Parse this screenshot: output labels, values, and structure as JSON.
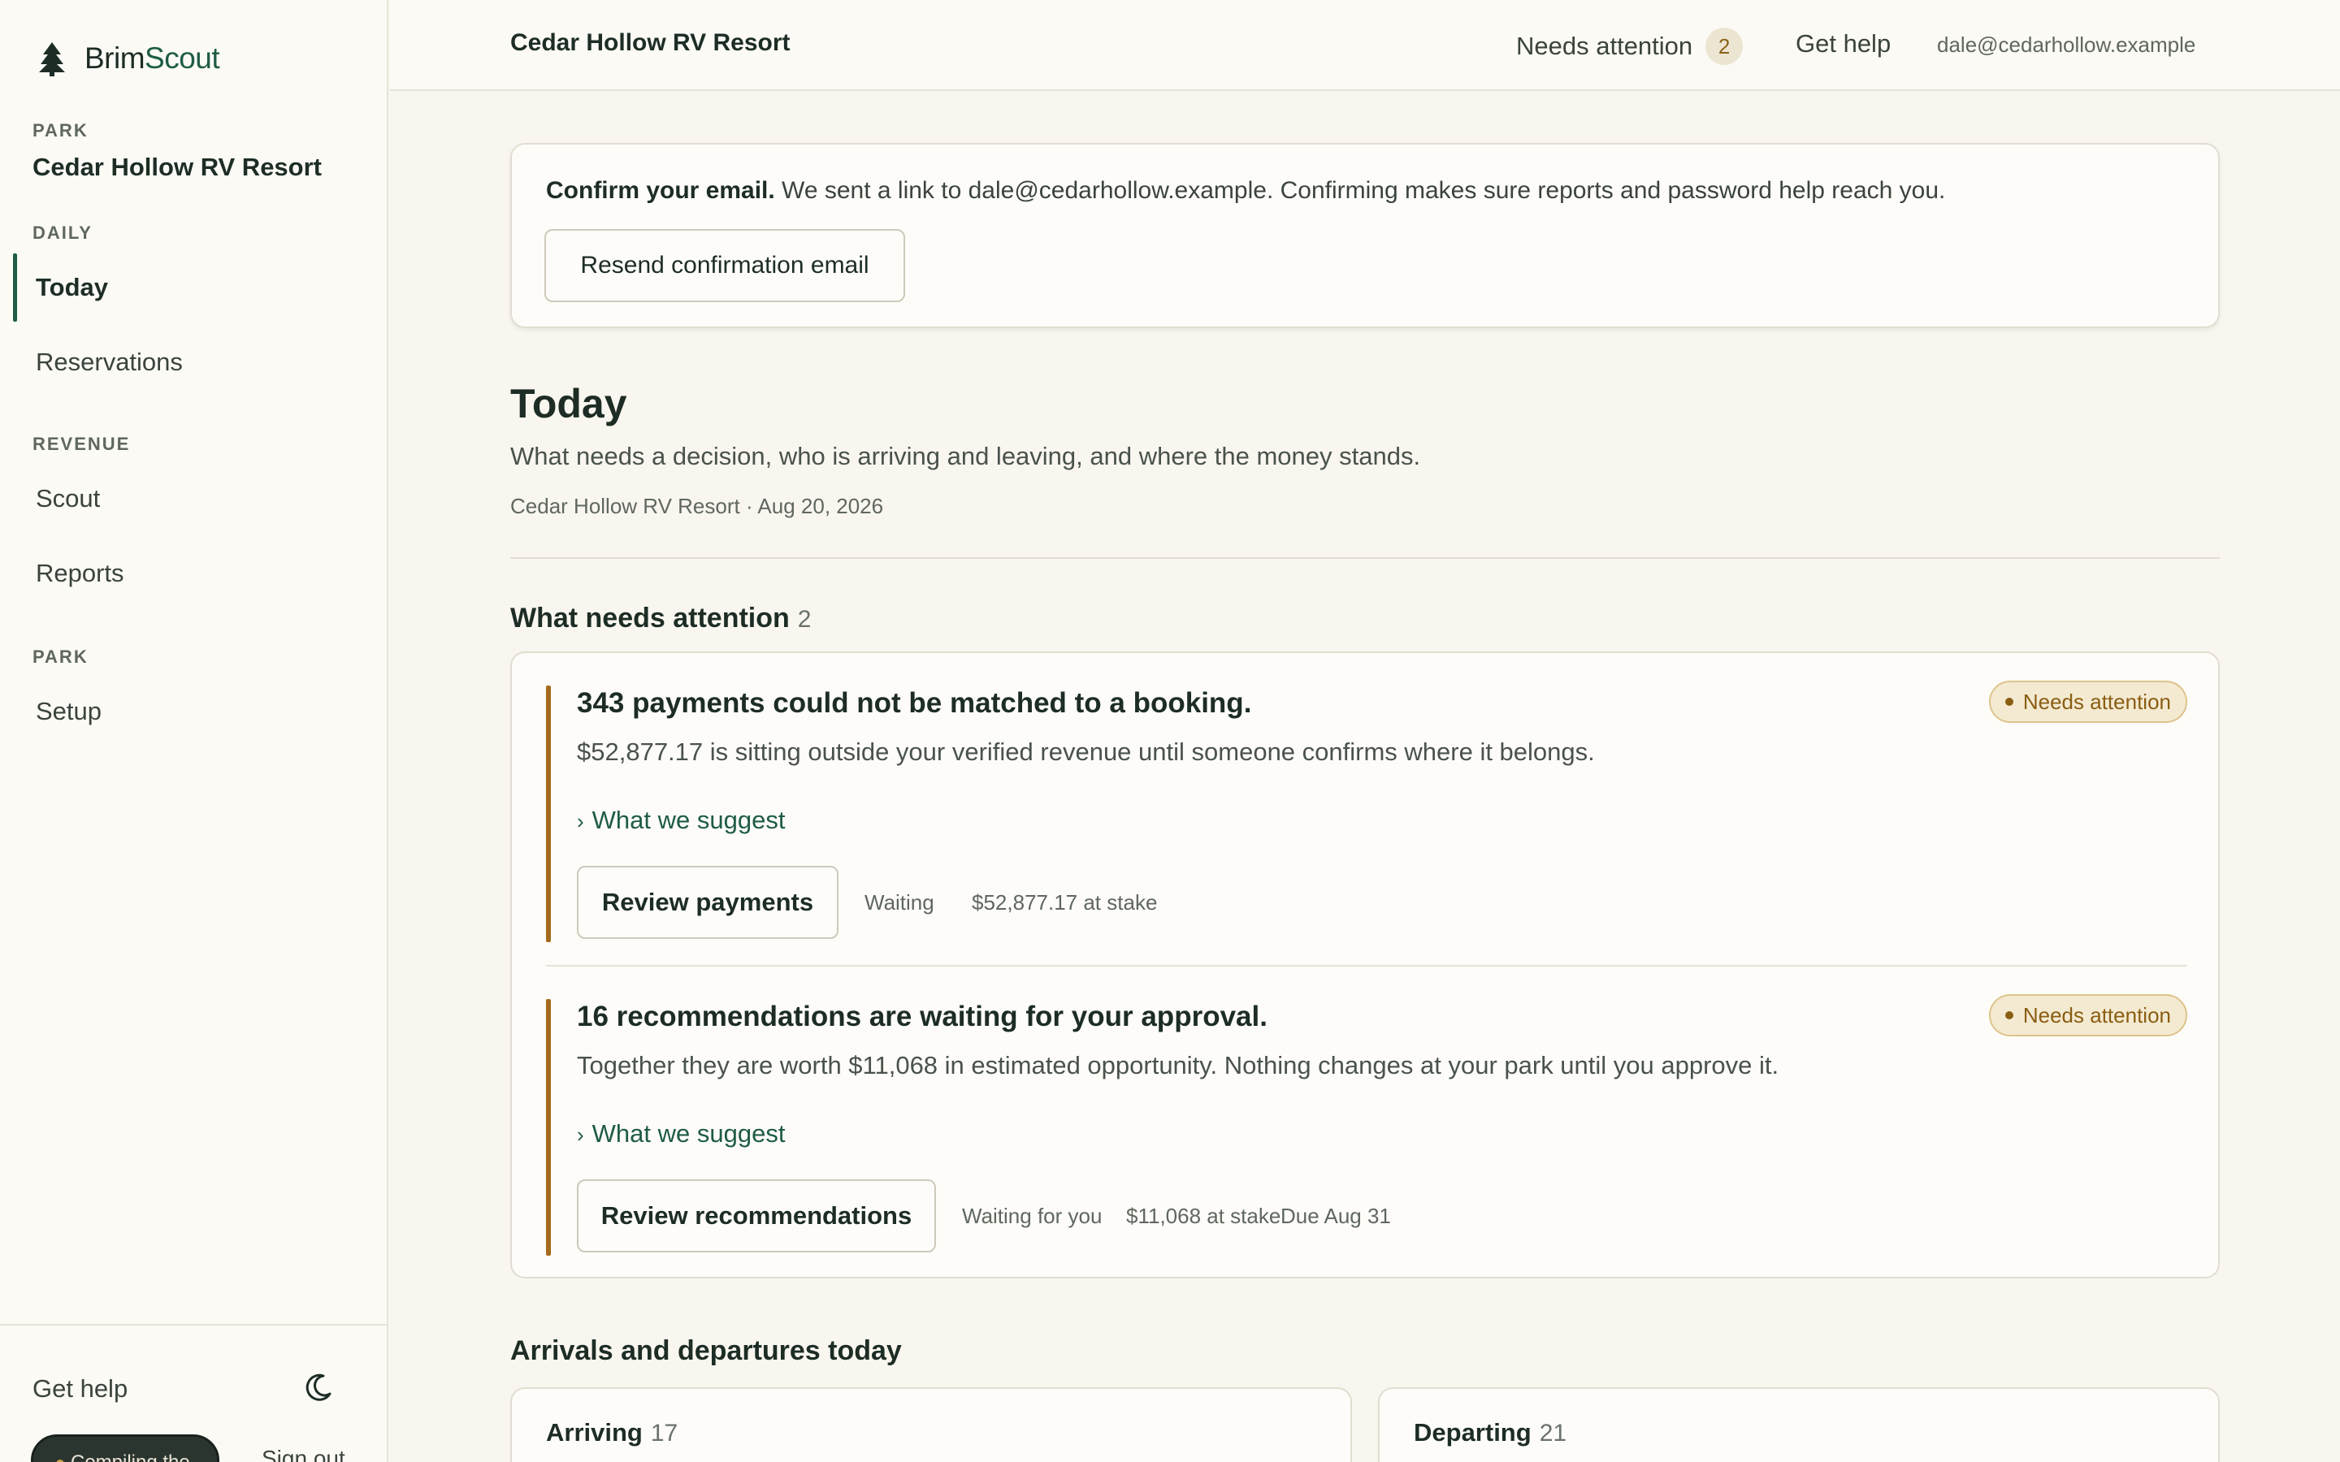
{
  "brand": {
    "name_a": "Brim",
    "name_b": "Scout"
  },
  "sidebar": {
    "section_park": "PARK",
    "park_name": "Cedar Hollow RV Resort",
    "section_daily": "DAILY",
    "section_revenue": "REVENUE",
    "section_park2": "PARK",
    "items": [
      {
        "label": "Today"
      },
      {
        "label": "Reservations"
      },
      {
        "label": "Scout"
      },
      {
        "label": "Reports"
      },
      {
        "label": "Setup"
      }
    ],
    "help": "Get help",
    "pill_label": "Compiling the",
    "signout": "Sign out"
  },
  "header": {
    "title": "Cedar Hollow RV Resort",
    "attention_label": "Needs attention",
    "attention_count": "2",
    "help": "Get help",
    "email": "dale@cedarhollow.example"
  },
  "confirm": {
    "bold": "Confirm your email.",
    "text": " We sent a link to dale@cedarhollow.example. Confirming makes sure reports and password help reach you.",
    "button": "Resend confirmation email"
  },
  "page": {
    "title": "Today",
    "subtitle": "What needs a decision, who is arriving and leaving, and where the money stands.",
    "meta": "Cedar Hollow RV Resort · Aug 20, 2026"
  },
  "attention": {
    "title": "What needs attention",
    "count": "2",
    "items": [
      {
        "headline": "343 payments could not be matched to a booking.",
        "body": "$52,877.17 is sitting outside your verified revenue until someone confirms where it belongs.",
        "suggest": "What we suggest",
        "button": "Review payments",
        "status": "Needs attention",
        "meta": [
          "Waiting",
          "$52,877.17 at stake"
        ]
      },
      {
        "headline": "16 recommendations are waiting for your approval.",
        "body": "Together they are worth $11,068 in estimated opportunity. Nothing changes at your park until you approve it.",
        "suggest": "What we suggest",
        "button": "Review recommendations",
        "status": "Needs attention",
        "meta": [
          "Waiting for you",
          "$11,068 at stake",
          "Due Aug 31"
        ]
      }
    ]
  },
  "arrivals": {
    "title": "Arrivals and departures today",
    "arriving_label": "Arriving",
    "arriving_count": "17",
    "departing_label": "Departing",
    "departing_count": "21"
  },
  "colors": {
    "accent": "#1f5c45",
    "warning": "#a46b1d",
    "background": "#f8f6ef"
  },
  "icons": {
    "brand": "pine-tree-icon",
    "theme": "moon-icon",
    "disclosure": "chevron-right-icon",
    "status": "dot-icon"
  }
}
